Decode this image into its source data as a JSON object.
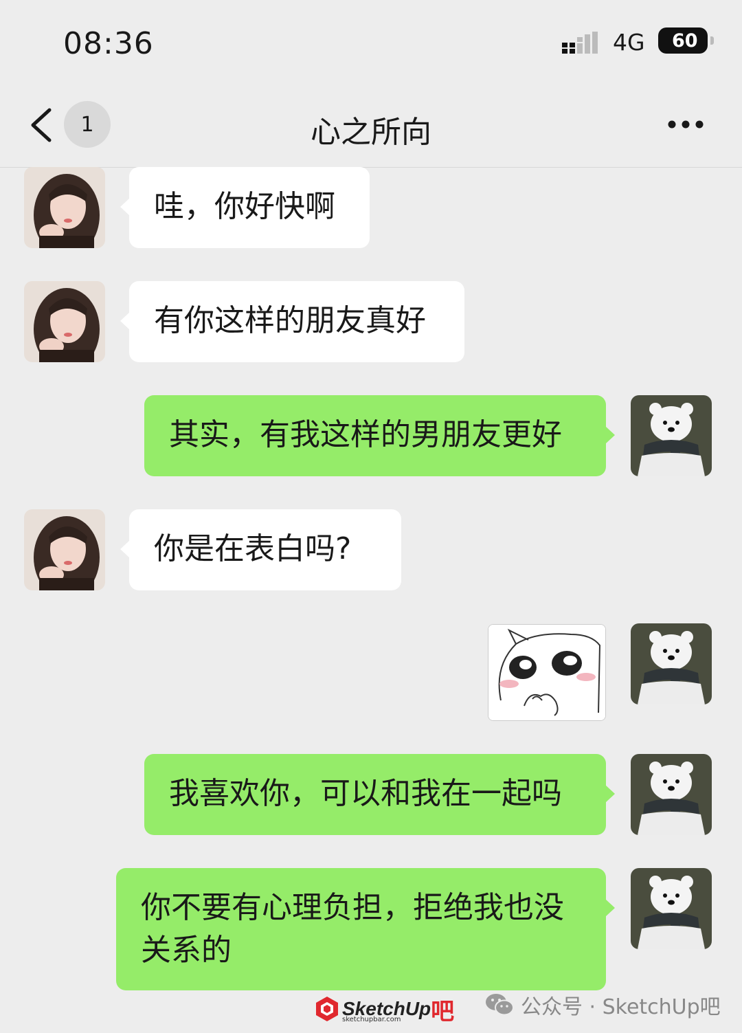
{
  "status_bar": {
    "time": "08:36",
    "network": "4G",
    "battery": "60"
  },
  "nav": {
    "unread_count": "1",
    "title": "心之所向"
  },
  "messages": [
    {
      "side": "in",
      "type": "text",
      "text": "哇，你好快啊"
    },
    {
      "side": "in",
      "type": "text",
      "text": "有你这样的朋友真好"
    },
    {
      "side": "out",
      "type": "text",
      "text": "其实，有我这样的男朋友更好"
    },
    {
      "side": "in",
      "type": "text",
      "text": "你是在表白吗?"
    },
    {
      "side": "out",
      "type": "sticker",
      "sticker": "blushing-cat-sticker"
    },
    {
      "side": "out",
      "type": "text",
      "text": "我喜欢你，可以和我在一起吗"
    },
    {
      "side": "out",
      "type": "text",
      "text": "你不要有心理负担，拒绝我也没关系的"
    }
  ],
  "watermark": {
    "logo_text": "SketchUp",
    "logo_suffix": "吧",
    "logo_url": "sketchupbar.com",
    "account": "公众号 · SketchUp吧"
  },
  "colors": {
    "background": "#ededed",
    "incoming": "#ffffff",
    "outgoing": "#95ec69"
  },
  "icons": [
    "back-chevron-icon",
    "more-icon",
    "signal-icon",
    "battery-icon",
    "wechat-icon"
  ]
}
